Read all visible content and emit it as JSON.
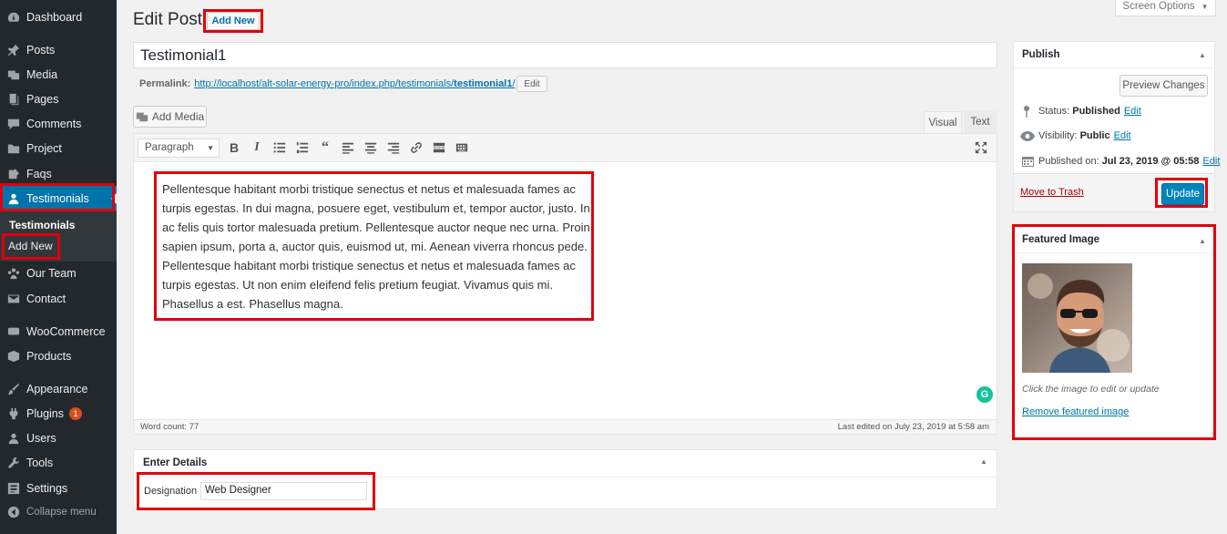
{
  "sidebar": {
    "items": [
      {
        "label": "Dashboard",
        "icon": "dashboard-icon"
      },
      {
        "label": "Posts",
        "icon": "pin-icon"
      },
      {
        "label": "Media",
        "icon": "media-icon"
      },
      {
        "label": "Pages",
        "icon": "pages-icon"
      },
      {
        "label": "Comments",
        "icon": "comment-icon"
      },
      {
        "label": "Project",
        "icon": "folder-icon"
      },
      {
        "label": "Faqs",
        "icon": "faq-icon"
      },
      {
        "label": "Testimonials",
        "icon": "user-icon"
      },
      {
        "label": "Our Team",
        "icon": "team-icon"
      },
      {
        "label": "Contact",
        "icon": "mail-icon"
      },
      {
        "label": "WooCommerce",
        "icon": "woo-icon"
      },
      {
        "label": "Products",
        "icon": "box-icon"
      },
      {
        "label": "Appearance",
        "icon": "brush-icon"
      },
      {
        "label": "Plugins",
        "icon": "plugin-icon",
        "badge": "1"
      },
      {
        "label": "Users",
        "icon": "users-icon"
      },
      {
        "label": "Tools",
        "icon": "wrench-icon"
      },
      {
        "label": "Settings",
        "icon": "settings-icon"
      },
      {
        "label": "Collapse menu",
        "icon": "collapse-icon"
      }
    ],
    "submenu": [
      "Testimonials",
      "Add New"
    ]
  },
  "header": {
    "title": "Edit Post",
    "add_new": "Add New",
    "screen_options": "Screen Options"
  },
  "post": {
    "title": "Testimonial1",
    "permalink_label": "Permalink:",
    "permalink_base": "http://localhost/alt-solar-energy-pro/index.php/testimonials/",
    "permalink_slug": "testimonial1",
    "permalink_end": "/",
    "edit_label": "Edit"
  },
  "editor": {
    "add_media": "Add Media",
    "tab_visual": "Visual",
    "tab_text": "Text",
    "format": "Paragraph",
    "content": "Pellentesque habitant morbi tristique senectus et netus et malesuada fames ac turpis egestas. In dui magna, posuere eget, vestibulum et, tempor auctor, justo. In ac felis quis tortor malesuada pretium. Pellentesque auctor neque nec urna. Proin sapien ipsum, porta a, auctor quis, euismod ut, mi. Aenean viverra rhoncus pede. Pellentesque habitant morbi tristique senectus et netus et malesuada fames ac turpis egestas. Ut non enim eleifend felis pretium feugiat. Vivamus quis mi. Phasellus a est. Phasellus magna.",
    "word_count": "Word count: 77",
    "last_edited": "Last edited on July 23, 2019 at 5:58 am"
  },
  "details": {
    "title": "Enter Details",
    "designation_label": "Designation",
    "designation_value": "Web Designer"
  },
  "publish": {
    "title": "Publish",
    "preview": "Preview Changes",
    "status_label": "Status:",
    "status_value": "Published",
    "visibility_label": "Visibility:",
    "visibility_value": "Public",
    "published_label": "Published on:",
    "published_value": "Jul 23, 2019 @ 05:58",
    "edit": "Edit",
    "trash": "Move to Trash",
    "update": "Update"
  },
  "featured": {
    "title": "Featured Image",
    "hint": "Click the image to edit or update",
    "remove": "Remove featured image"
  },
  "colors": {
    "sidebar_bg": "#23282d",
    "accent": "#0073aa",
    "highlight": "#e0000f"
  }
}
